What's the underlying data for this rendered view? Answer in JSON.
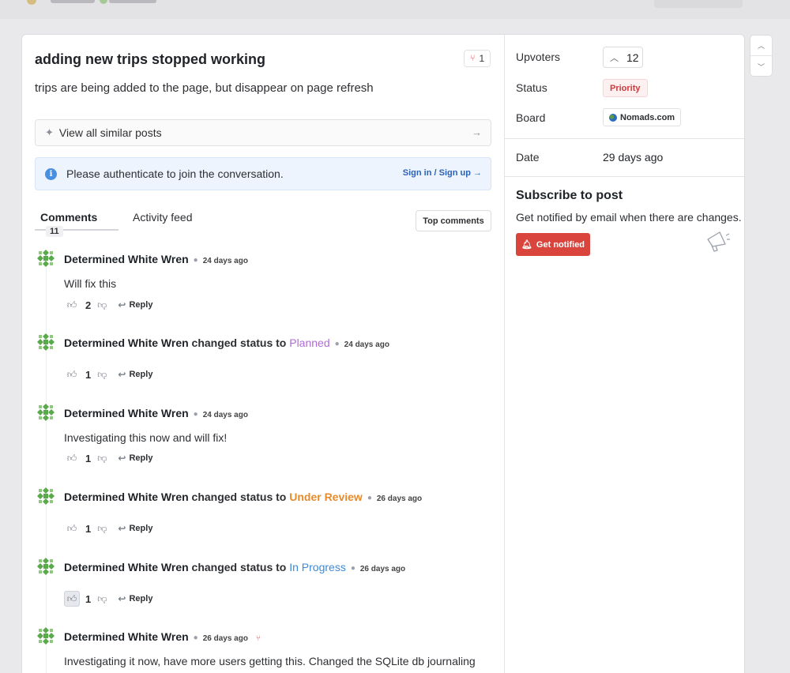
{
  "post": {
    "title": "adding new trips stopped working",
    "merged_count": "1",
    "description": "trips are being added to the page, but disappear on page refresh"
  },
  "similar": {
    "label": "View all similar posts"
  },
  "auth": {
    "message": "Please authenticate to join the conversation.",
    "link": "Sign in / Sign up →"
  },
  "tabs": {
    "comments_label": "Comments",
    "comments_count": "11",
    "activity_label": "Activity feed",
    "sort_label": "Top comments"
  },
  "comments": [
    {
      "author": "Determined White Wren",
      "time": "24 days ago",
      "body": "Will fix this",
      "votes": "2",
      "reply": "Reply"
    },
    {
      "author": "Determined White Wren",
      "changed": "changed status to",
      "status": "Planned",
      "time": "24 days ago",
      "votes": "1",
      "reply": "Reply"
    },
    {
      "author": "Determined White Wren",
      "time": "24 days ago",
      "body": "Investigating this now and will fix!",
      "votes": "1",
      "reply": "Reply"
    },
    {
      "author": "Determined White Wren",
      "changed": "changed status to",
      "status": "Under Review",
      "time": "26 days ago",
      "votes": "1",
      "reply": "Reply"
    },
    {
      "author": "Determined White Wren",
      "changed": "changed status to",
      "status": "In Progress",
      "time": "26 days ago",
      "votes": "1",
      "reply": "Reply"
    },
    {
      "author": "Determined White Wren",
      "time": "26 days ago",
      "body": "Investigating it now, have more users getting this. Changed the SQLite db journaling mode to WAL now which MAY fix it. Let's see."
    }
  ],
  "side": {
    "upvoters_label": "Upvoters",
    "upvote_count": "12",
    "status_label": "Status",
    "status_value": "Priority",
    "board_label": "Board",
    "board_value": "Nomads.com",
    "date_label": "Date",
    "date_value": "29 days ago",
    "subscribe_title": "Subscribe to post",
    "subscribe_desc": "Get notified by email when there are changes.",
    "notify_button": "Get notified"
  },
  "colors": {
    "status_planned": "#b06bd6",
    "status_under_review": "#e98b2a",
    "status_in_progress": "#3b8ad9",
    "priority": "#d03a3a",
    "notify_button": "#d9453d",
    "link": "#2a62b8"
  },
  "icons": {
    "merge": "merge-icon",
    "sparkle": "sparkle-icon",
    "info": "info-icon",
    "thumb_up": "thumb-up-icon",
    "thumb_down": "thumb-down-icon",
    "reply": "reply-icon",
    "bell": "bell-icon",
    "megaphone": "megaphone-icon",
    "chevron_up": "chevron-up-icon",
    "chevron_down": "chevron-down-icon"
  }
}
